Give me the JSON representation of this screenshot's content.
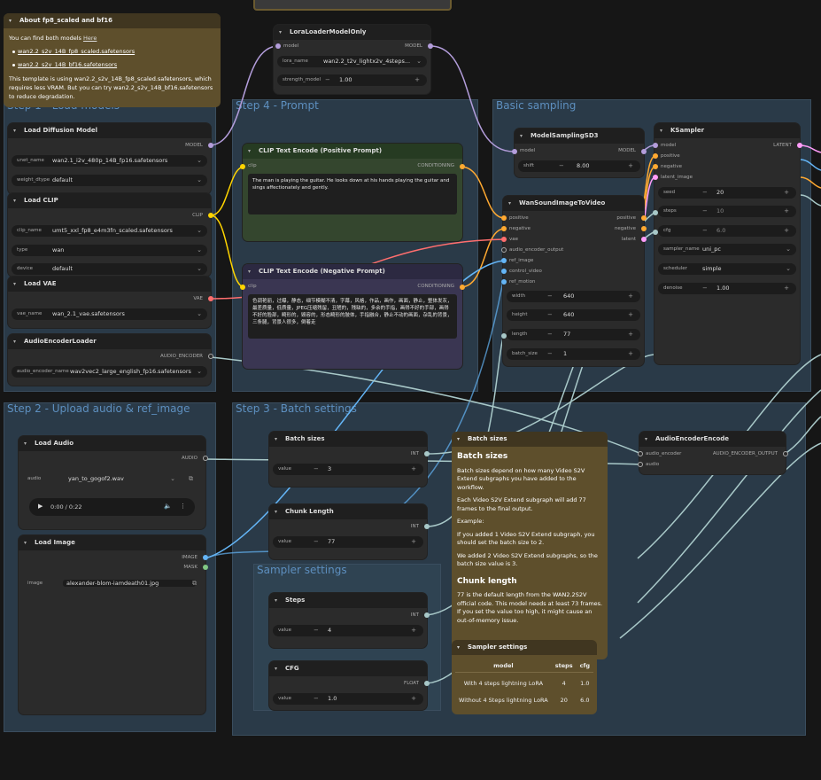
{
  "groups": {
    "load_models": "Step 1 - Load models",
    "prompt": "Step 4 - Prompt",
    "basic_sampling": "Basic sampling",
    "upload": "Step 2 - Upload audio & ref_image",
    "batch": "Step 3 - Batch settings",
    "sampler_settings": "Sampler settings"
  },
  "about_note": {
    "title": "About fp8_scaled and bf16",
    "line1": "You can find both models",
    "here_link": "Here",
    "files": [
      "wan2.2_s2v_14B_fp8_scaled.safetensors",
      "wan2.2_s2v_14B_bf16.safetensors"
    ],
    "body": "This template is using wan2.2_s2v_14B_fp8_scaled.safetensors, which requires less VRAM. But you can try wan2.2_s2v_14B_bf16.safetensors to reduce degradation."
  },
  "lora": {
    "title": "LoraLoaderModelOnly",
    "in_model": "model",
    "out_model": "MODEL",
    "lora_name_label": "lora_name",
    "lora_name": "wan2.2_t2v_lightx2v_4steps...",
    "strength_label": "strength_model",
    "strength": "1.00"
  },
  "diffusion": {
    "title": "Load Diffusion Model",
    "out": "MODEL",
    "unet_label": "unet_name",
    "unet": "wan2.1_i2v_480p_14B_fp16.safetensors",
    "dtype_label": "weight_dtype",
    "dtype": "default"
  },
  "clip": {
    "title": "Load CLIP",
    "out": "CLIP",
    "name_label": "clip_name",
    "name": "umt5_xxl_fp8_e4m3fn_scaled.safetensors",
    "type_label": "type",
    "type": "wan",
    "device_label": "device",
    "device": "default"
  },
  "vae": {
    "title": "Load VAE",
    "out": "VAE",
    "name_label": "vae_name",
    "name": "wan_2.1_vae.safetensors"
  },
  "audio_encoder_loader": {
    "title": "AudioEncoderLoader",
    "out": "AUDIO_ENCODER",
    "name_label": "audio_encoder_name",
    "name": "wav2vec2_large_english_fp16.safetensors"
  },
  "pos_prompt": {
    "title": "CLIP Text Encode (Positive Prompt)",
    "in": "clip",
    "out": "CONDITIONING",
    "text": "The man is playing the guitar. He looks down at his hands playing the guitar and sings affectionately and gently."
  },
  "neg_prompt": {
    "title": "CLIP Text Encode (Negative Prompt)",
    "in": "clip",
    "out": "CONDITIONING",
    "text": "色调艳丽，过曝，静态，细节模糊不清，字幕，风格，作品，画作，画面，静止，整体发灰，最差质量，低质量，JPEG压缩残留，丑陋的，残缺的，多余的手指，画得不好的手部，画得不好的脸部，畸形的，毁容的，形态畸形的肢体，手指融合，静止不动的画面，杂乱的背景，三条腿，背景人很多，倒着走"
  },
  "model_sampling": {
    "title": "ModelSamplingSD3",
    "in": "model",
    "out": "MODEL",
    "shift_label": "shift",
    "shift": "8.00"
  },
  "wan_s2v": {
    "title": "WanSoundImageToVideo",
    "inputs": [
      "positive",
      "negative",
      "vae",
      "audio_encoder_output",
      "ref_image",
      "control_video",
      "ref_motion"
    ],
    "outputs": [
      "positive",
      "negative",
      "latent"
    ],
    "width_label": "width",
    "width": "640",
    "height_label": "height",
    "height": "640",
    "length_label": "length",
    "length": "77",
    "batch_label": "batch_size",
    "batch": "1"
  },
  "ksampler": {
    "title": "KSampler",
    "inputs": [
      "model",
      "positive",
      "negative",
      "latent_image"
    ],
    "out": "LATENT",
    "seed_label": "seed",
    "seed": "20",
    "steps_label": "steps",
    "steps": "10",
    "cfg_label": "cfg",
    "cfg": "6.0",
    "sampler_label": "sampler_name",
    "sampler": "uni_pc",
    "scheduler_label": "scheduler",
    "scheduler": "simple",
    "denoise_label": "denoise",
    "denoise": "1.00"
  },
  "load_audio": {
    "title": "Load Audio",
    "out": "AUDIO",
    "label": "audio",
    "file": "yan_to_gogof2.wav",
    "time": "0:00 / 0:22"
  },
  "load_image": {
    "title": "Load Image",
    "out_image": "IMAGE",
    "out_mask": "MASK",
    "label": "image",
    "file": "alexander-blom-iamdeath01.jpg"
  },
  "batch_sizes": {
    "title": "Batch sizes",
    "out": "INT",
    "label": "value",
    "value": "3"
  },
  "chunk_length": {
    "title": "Chunk Length",
    "out": "INT",
    "label": "value",
    "value": "77"
  },
  "steps_node": {
    "title": "Steps",
    "out": "INT",
    "label": "value",
    "value": "4"
  },
  "cfg_node": {
    "title": "CFG",
    "out": "FLOAT",
    "label": "value",
    "value": "1.0"
  },
  "batch_note": {
    "title": "Batch sizes",
    "h1": "Batch sizes",
    "p1": "Batch sizes depend on how many Video S2V Extend subgraphs you have added to the workflow.",
    "p2": "Each Video S2V Extend subgraph will add 77 frames to the final output.",
    "p3": "Example:",
    "p4": "If you added 1 Video S2V Extend subgraph, you should set the batch size to 2.",
    "p5": "We added 2 Video S2V Extend subgraphs, so the batch size value is 3.",
    "h2": "Chunk length",
    "p6": "77 is the default length from the WAN2.2S2V official code. This model needs at least 73 frames. If you set the value too high, it might cause an out-of-memory issue."
  },
  "sampler_note": {
    "title": "Sampler settings",
    "headers": [
      "model",
      "steps",
      "cfg"
    ],
    "rows": [
      [
        "With 4 steps lightning LoRA",
        "4",
        "1.0"
      ],
      [
        "Without 4 Steps lightning LoRA",
        "20",
        "6.0"
      ]
    ]
  },
  "audio_encoder_encode": {
    "title": "AudioEncoderEncode",
    "in1": "audio_encoder",
    "in2": "audio",
    "out": "AUDIO_ENCODER_OUTPUT"
  },
  "colors": {
    "model": "#b39ddb",
    "clip": "#ffd500",
    "vae": "#ff6e6e",
    "conditioning": "#ffa931",
    "latent": "#ff9cf9",
    "image": "#64b5f6",
    "int": "#a8c8c8",
    "note": "#5e4f2c"
  }
}
